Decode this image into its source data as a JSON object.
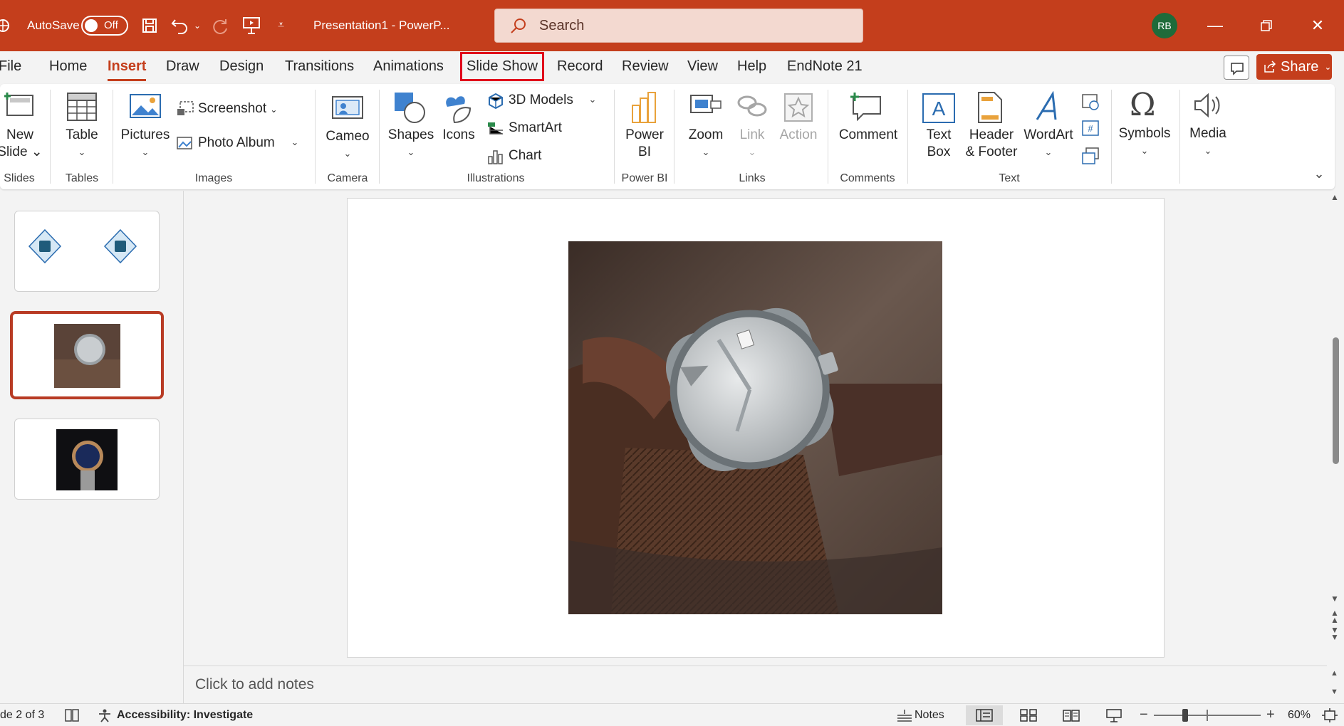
{
  "titlebar": {
    "autosave_label": "AutoSave",
    "autosave_state": "Off",
    "doc_title": "Presentation1  -  PowerP...",
    "search_placeholder": "Search",
    "user_initials": "RB"
  },
  "tabs": [
    "File",
    "Home",
    "Insert",
    "Draw",
    "Design",
    "Transitions",
    "Animations",
    "Slide Show",
    "Record",
    "Review",
    "View",
    "Help",
    "EndNote 21"
  ],
  "active_tab": "Insert",
  "highlighted_tab": "Slide Show",
  "share_label": "Share",
  "ribbon": {
    "new_slide": [
      "New",
      "Slide"
    ],
    "table": "Table",
    "pictures": "Pictures",
    "screenshot": "Screenshot",
    "photo_album": "Photo Album",
    "cameo": "Cameo",
    "shapes": "Shapes",
    "icons": "Icons",
    "models_3d": "3D Models",
    "smartart": "SmartArt",
    "chart": "Chart",
    "power_bi": [
      "Power",
      "BI"
    ],
    "zoom": "Zoom",
    "link": "Link",
    "action": "Action",
    "comment": "Comment",
    "text_box": [
      "Text",
      "Box"
    ],
    "header_footer": [
      "Header",
      "& Footer"
    ],
    "wordart": "WordArt",
    "symbols": "Symbols",
    "media": "Media",
    "groups": {
      "slides": "Slides",
      "tables": "Tables",
      "images": "Images",
      "camera": "Camera",
      "illustrations": "Illustrations",
      "power_bi": "Power BI",
      "links": "Links",
      "comments": "Comments",
      "text": "Text"
    }
  },
  "notes_placeholder": "Click to add notes",
  "status": {
    "slide_counter": "de 2 of 3",
    "accessibility": "Accessibility: Investigate",
    "notes": "Notes",
    "zoom": "60%"
  },
  "colors": {
    "brand": "#c43e1c",
    "highlight": "#e0001b",
    "thumb_selected": "#b83b24"
  }
}
